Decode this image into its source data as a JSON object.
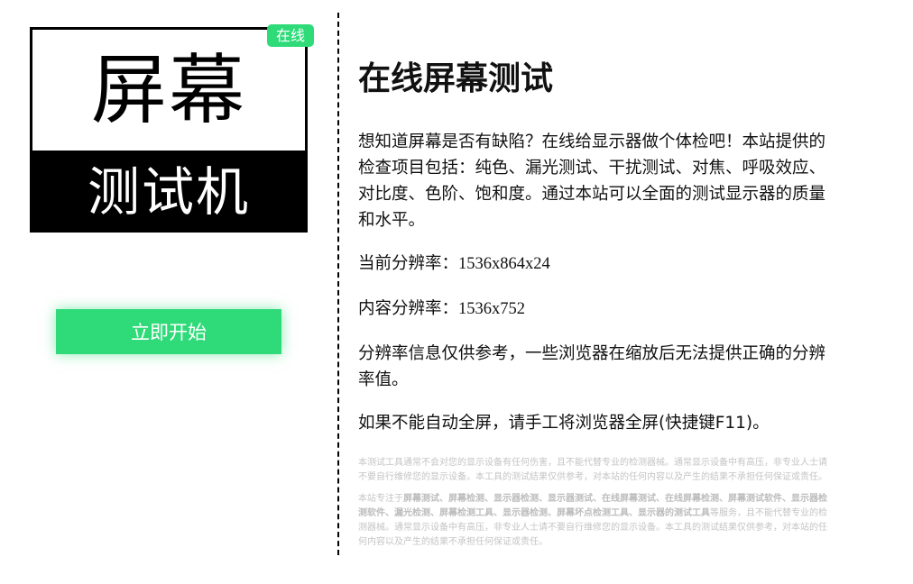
{
  "logo": {
    "top_text": "屏幕",
    "bottom_text": "测试机",
    "badge": "在线"
  },
  "start_button": "立即开始",
  "main": {
    "title": "在线屏幕测试",
    "description": "想知道屏幕是否有缺陷？在线给显示器做个体检吧！本站提供的检查项目包括：纯色、漏光测试、干扰测试、对焦、呼吸效应、对比度、色阶、饱和度。通过本站可以全面的测试显示器的质量和水平。",
    "current_resolution_label": "当前分辨率：",
    "current_resolution_value": "1536x864x24",
    "content_resolution_label": "内容分辨率：",
    "content_resolution_value": "1536x752",
    "resolution_note": "分辨率信息仅供参考，一些浏览器在缩放后无法提供正确的分辨率值。",
    "fullscreen_note": "如果不能自动全屏，请手工将浏览器全屏(快捷键F11)。"
  },
  "disclaimer": {
    "p1": "本测试工具通常不会对您的显示设备有任何伤害，且不能代替专业的检测器械。通常显示设备中有高压，非专业人士请不要自行维修您的显示设备。本工具的测试结果仅供参考，对本站的任何内容以及产生的结果不承担任何保证或责任。",
    "p2_prefix": "本站专注于",
    "p2_keywords": "屏幕测试、屏幕检测、显示器检测、显示器测试、在线屏幕测试、在线屏幕检测、屏幕测试软件、显示器检测软件、漏光检测、屏幕检测工具、显示器检测、屏幕坏点检测工具、显示器的测试工具",
    "p2_suffix": "等服务，且不能代替专业的检测器械。通常显示设备中有高压，非专业人士请不要自行维修您的显示设备。本工具的测试结果仅供参考，对本站的任何内容以及产生的结果不承担任何保证或责任。"
  },
  "colors": {
    "accent_green": "#2fdb79",
    "text": "#111111",
    "fine_text": "#c4c4c4"
  }
}
